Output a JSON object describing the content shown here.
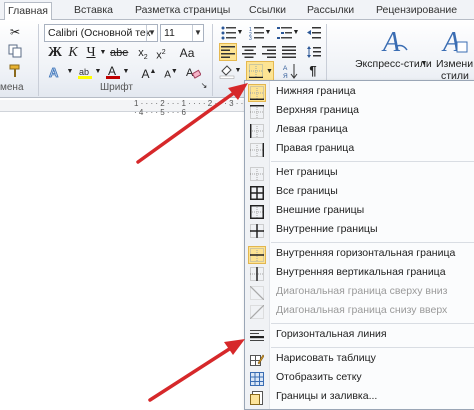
{
  "tabs": [
    {
      "label": "Главная",
      "active": true
    },
    {
      "label": "Вставка"
    },
    {
      "label": "Разметка страницы"
    },
    {
      "label": "Ссылки"
    },
    {
      "label": "Рассылки"
    },
    {
      "label": "Рецензирование"
    }
  ],
  "ribbon": {
    "clipboard_label": "мена",
    "font_group_label": "Шрифт",
    "font_name": "Calibri (Основной тек",
    "font_size": "11",
    "styles": {
      "express_styles": "Экспресс-стили",
      "change_styles_line1": "Измени",
      "change_styles_line2": "стили"
    }
  },
  "ruler": {
    "marks": "1 · · · · 2 · · · 1 · · · · 2 · · · 3 · · · 4 · · · 5 · · · 6"
  },
  "menu": {
    "items": [
      {
        "label": "Нижняя граница",
        "icon": "bottom-border-icon",
        "highlighted": true
      },
      {
        "label": "Верхняя граница",
        "icon": "top-border-icon"
      },
      {
        "label": "Левая граница",
        "icon": "left-border-icon"
      },
      {
        "label": "Правая граница",
        "icon": "right-border-icon"
      },
      {
        "label": "Нет границы",
        "icon": "no-border-icon"
      },
      {
        "label": "Все границы",
        "icon": "all-borders-icon"
      },
      {
        "label": "Внешние границы",
        "icon": "outside-borders-icon"
      },
      {
        "label": "Внутренние границы",
        "icon": "inside-borders-icon"
      },
      {
        "label": "Внутренняя горизонтальная граница",
        "icon": "inside-horizontal-border-icon",
        "highlighted": true
      },
      {
        "label": "Внутренняя вертикальная граница",
        "icon": "inside-vertical-border-icon"
      },
      {
        "label": "Диагональная граница сверху вниз",
        "icon": "diagonal-down-border-icon",
        "disabled": true
      },
      {
        "label": "Диагональная граница снизу вверх",
        "icon": "diagonal-up-border-icon",
        "disabled": true
      },
      {
        "label": "Горизонтальная линия",
        "icon": "horizontal-line-icon"
      },
      {
        "label": "Нарисовать таблицу",
        "icon": "draw-table-icon"
      },
      {
        "label": "Отобразить сетку",
        "icon": "view-gridlines-icon"
      },
      {
        "label": "Границы и заливка...",
        "icon": "borders-and-shading-icon"
      }
    ]
  },
  "colors": {
    "arrow": "#d6282a",
    "highlight": "#fde493",
    "font_color_bar": "#c00000",
    "highlight_bar": "#ffff00"
  }
}
